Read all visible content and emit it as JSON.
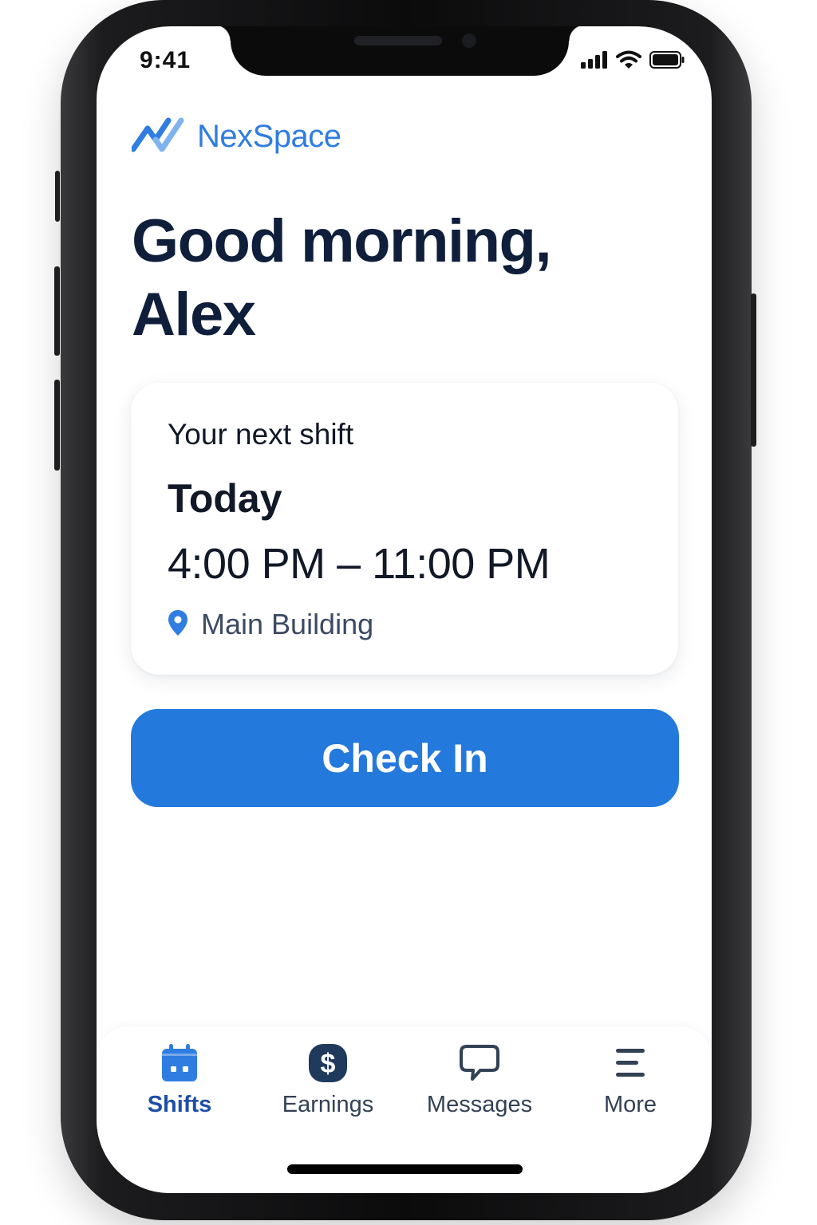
{
  "status_bar": {
    "time": "9:41",
    "signal_icon": "cellular-signal-icon",
    "wifi_icon": "wifi-icon",
    "battery_icon": "battery-icon"
  },
  "brand": {
    "name": "NexSpace",
    "logo_icon": "nexspace-logo-icon",
    "color": "#2f7de1"
  },
  "greeting": {
    "text": "Good morning, Alex"
  },
  "next_shift": {
    "label": "Your next shift",
    "day": "Today",
    "time_range": "4:00 PM – 11:00 PM",
    "location": "Main Building",
    "location_icon": "map-pin-icon"
  },
  "check_in_button": {
    "label": "Check In",
    "color": "#2379dc"
  },
  "tab_bar": {
    "active": "Shifts",
    "tabs": [
      {
        "label": "Shifts",
        "icon": "calendar-icon"
      },
      {
        "label": "Earnings",
        "icon": "dollar-icon"
      },
      {
        "label": "Messages",
        "icon": "chat-bubble-icon"
      },
      {
        "label": "More",
        "icon": "menu-icon"
      }
    ]
  },
  "colors": {
    "primary": "#2379dc",
    "heading": "#0f1e3a",
    "active_tab": "#1e4fa8"
  }
}
